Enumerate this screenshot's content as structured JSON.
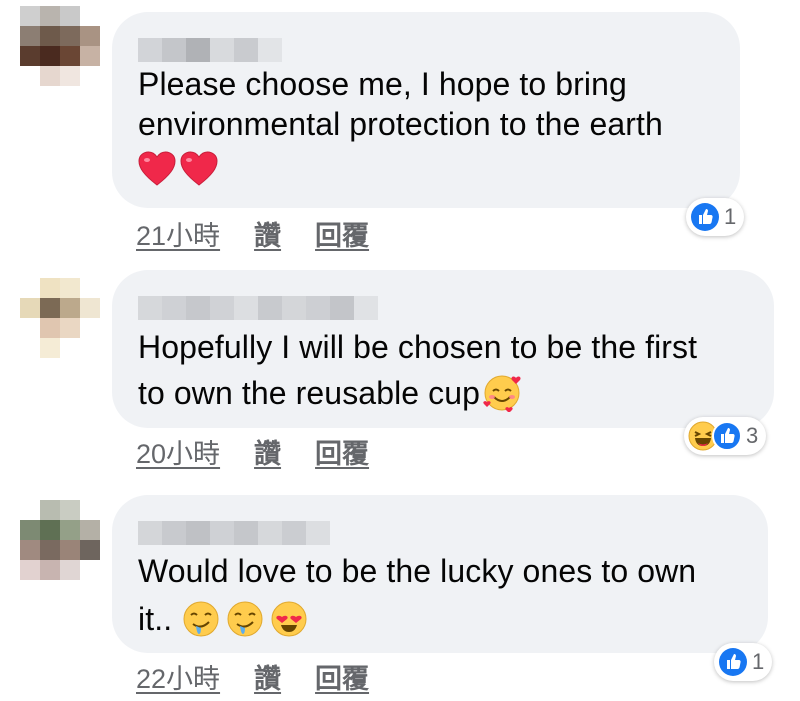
{
  "comments": [
    {
      "text_lines": [
        "Please choose me, I hope to bring",
        "environmental protection to the earth"
      ],
      "emojis": [
        "red-heart",
        "red-heart"
      ],
      "time": "21小時",
      "like_label": "讚",
      "reply_label": "回覆",
      "reactions": [
        "like"
      ],
      "reaction_count": "1"
    },
    {
      "text_lines": [
        "Hopefully I will be chosen to be the first",
        "to own the reusable cup"
      ],
      "emojis": [
        "smiling-face-with-hearts"
      ],
      "time": "20小時",
      "like_label": "讚",
      "reply_label": "回覆",
      "reactions": [
        "haha",
        "like"
      ],
      "reaction_count": "3"
    },
    {
      "text_lines": [
        "Would love to be the lucky ones to own",
        "it.."
      ],
      "emojis": [
        "drooling-face",
        "drooling-face",
        "heart-eyes"
      ],
      "time": "22小時",
      "like_label": "讚",
      "reply_label": "回覆",
      "reactions": [
        "like"
      ],
      "reaction_count": "1"
    }
  ],
  "colors": {
    "bubble": "#f0f2f5",
    "meta_text": "#65676b",
    "like_blue": "#1877f2",
    "heart_red": "#f0284a",
    "emoji_yellow": "#ffcc4d"
  }
}
